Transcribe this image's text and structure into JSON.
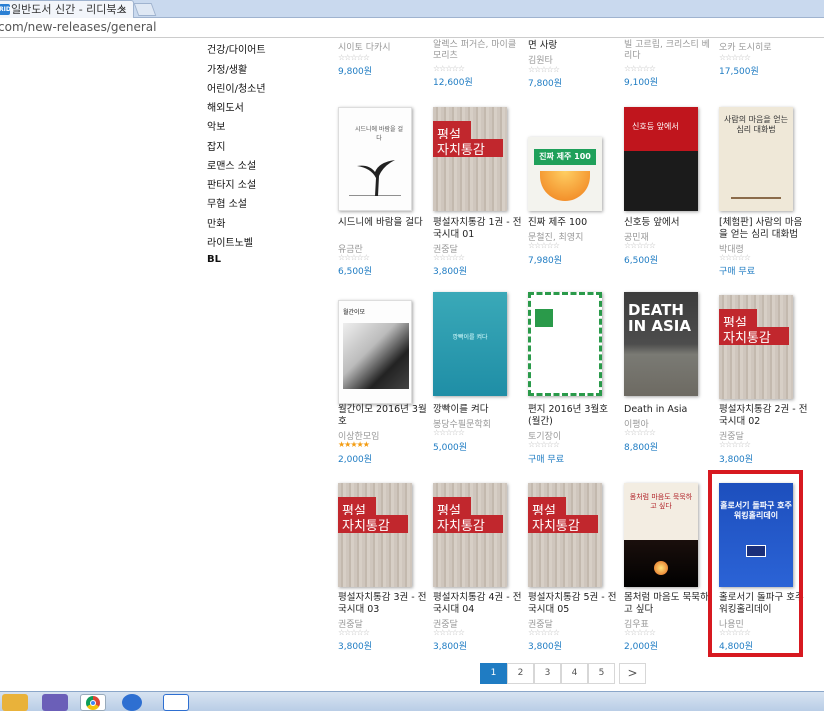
{
  "browser": {
    "tab_title": "일반도서 신간 - 리디북스",
    "tab_close": "×",
    "favicon": "RIDI",
    "url": "com/new-releases/general"
  },
  "sidebar": {
    "categories": [
      "건강/다이어트",
      "가정/생활",
      "어린이/청소년",
      "해외도서",
      "악보",
      "잡지",
      "로맨스 소설",
      "판타지 소설",
      "무협 소설",
      "만화",
      "라이트노벨",
      "BL"
    ]
  },
  "top_row": [
    {
      "title": "",
      "author": "시이토 다카시",
      "price": "9,800원"
    },
    {
      "title": "",
      "author": "알렉스 퍼거슨, 마이클 모리츠",
      "price": "12,600원"
    },
    {
      "title": "면 사랑",
      "author": "김원타",
      "price": "7,800원"
    },
    {
      "title": "",
      "author": "빌 고르립, 크리스티 베리다",
      "price": "9,100원"
    },
    {
      "title": "",
      "author": "오카 도시히로",
      "price": "17,500원"
    }
  ],
  "row2": [
    {
      "title": "시드니에 바람을 걸다",
      "author": "유금란",
      "price": "6,500원"
    },
    {
      "title": "평설자치통감 1권 - 전국시대 01",
      "author": "권중달",
      "price": "3,800원"
    },
    {
      "title": "진짜 제주 100",
      "author": "문철진, 최영지",
      "price": "7,980원"
    },
    {
      "title": "신호등 앞에서",
      "author": "공민재",
      "price": "6,500원"
    },
    {
      "title": "[체험판] 사람의 마음을 얻는 심리 대화법",
      "author": "박대령",
      "price": "구매 무료"
    }
  ],
  "row3": [
    {
      "title": "월간이모 2016년 3월호",
      "author": "이상한모임",
      "price": "2,000원",
      "rated": true
    },
    {
      "title": "깡빡이를 켜다",
      "author": "봉당수필문학회",
      "price": "5,000원"
    },
    {
      "title": "편지 2016년 3월호 (월간)",
      "author": "토기장이",
      "price": "구매 무료"
    },
    {
      "title": "Death in Asia",
      "author": "이평아",
      "price": "8,800원"
    },
    {
      "title": "평설자치통감 2권 - 전국시대 02",
      "author": "권중달",
      "price": "3,800원"
    }
  ],
  "row4": [
    {
      "title": "평설자치통감 3권 - 전국시대 03",
      "author": "권중달",
      "price": "3,800원"
    },
    {
      "title": "평설자치통감 4권 - 전국시대 04",
      "author": "권중달",
      "price": "3,800원"
    },
    {
      "title": "평설자치통감 5권 - 전국시대 05",
      "author": "권중달",
      "price": "3,800원"
    },
    {
      "title": "몸처럼 마음도 묵묵하고 싶다",
      "author": "김우표",
      "price": "2,000원"
    },
    {
      "title": "홀로서기 돌파구 호주 워킹홀리데이",
      "author": "나용민",
      "price": "4,800원"
    }
  ],
  "covers": {
    "wood_label_a": "평설",
    "wood_label_b": "자치통감",
    "jeju_band": "진짜 제주 100",
    "death_title": "DEATH IN ASIA",
    "aus_title": "홀로서기 돌파구 호주 워킹홀리데이",
    "sydney_caption": "시드니에 바람을 걸다",
    "psych_title": "사람의 마음을 얻는 심리 대화법",
    "signal_title": "신호등 앞에서",
    "teal_caption": "깡빡이를 켜다",
    "mind_title": "몸처럼 마음도 묵묵하고 싶다",
    "monthly_title": "월간이모"
  },
  "stars": "☆☆☆☆☆",
  "stars_rated": "★★★★★",
  "pagination": {
    "pages": [
      "1",
      "2",
      "3",
      "4",
      "5"
    ],
    "next": ">",
    "current": "1"
  },
  "colors": {
    "accent": "#1f7cc3",
    "highlight": "#d71920"
  }
}
